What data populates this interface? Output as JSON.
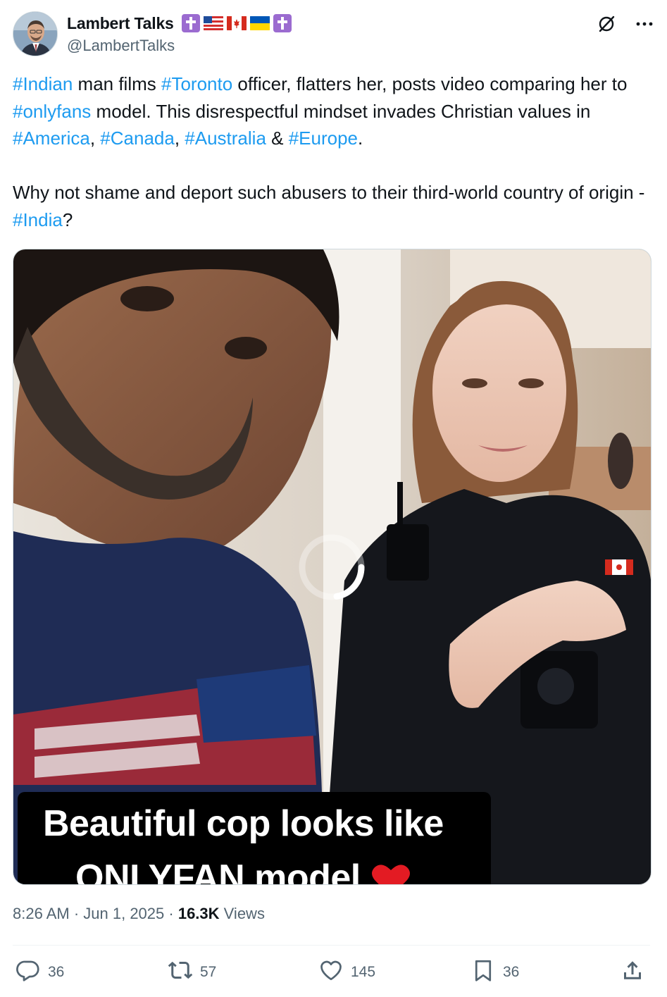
{
  "author": {
    "display_name": "Lambert Talks",
    "handle": "@LambertTalks",
    "badges": [
      "latin-cross-emoji",
      "us-flag-emoji",
      "canada-flag-emoji",
      "ukraine-flag-emoji",
      "latin-cross-emoji"
    ]
  },
  "tweet": {
    "p1_tag1": "#Indian",
    "p1_t1": " man films ",
    "p1_tag2": "#Toronto",
    "p1_t2": " officer, flatters her, posts video comparing her to ",
    "p1_tag3": "#onlyfans",
    "p1_t3": " model. This disrespectful mindset invades Christian values in ",
    "p1_tag4": "#America",
    "p1_t4": ", ",
    "p1_tag5": "#Canada",
    "p1_t5": ", ",
    "p1_tag6": "#Australia",
    "p1_t6": " & ",
    "p1_tag7": "#Europe",
    "p1_t7": ".",
    "p2_t1": "Why not shame and deport such abusers to their third-world country of origin - ",
    "p2_tag1": "#India",
    "p2_t2": "?"
  },
  "media": {
    "caption_line1": "Beautiful cop looks like",
    "caption_line2": "ONLYFAN model",
    "caption_emoji": "heart-emoji"
  },
  "meta": {
    "time": "8:26 AM",
    "sep1": " · ",
    "date": "Jun 1, 2025",
    "sep2": " · ",
    "views_count": "16.3K",
    "views_label": " Views"
  },
  "actions": {
    "replies": "36",
    "reposts": "57",
    "likes": "145",
    "bookmarks": "36"
  },
  "colors": {
    "text": "#0f1419",
    "secondary": "#536471",
    "link": "#1d9bf0",
    "divider": "#eff3f4"
  }
}
